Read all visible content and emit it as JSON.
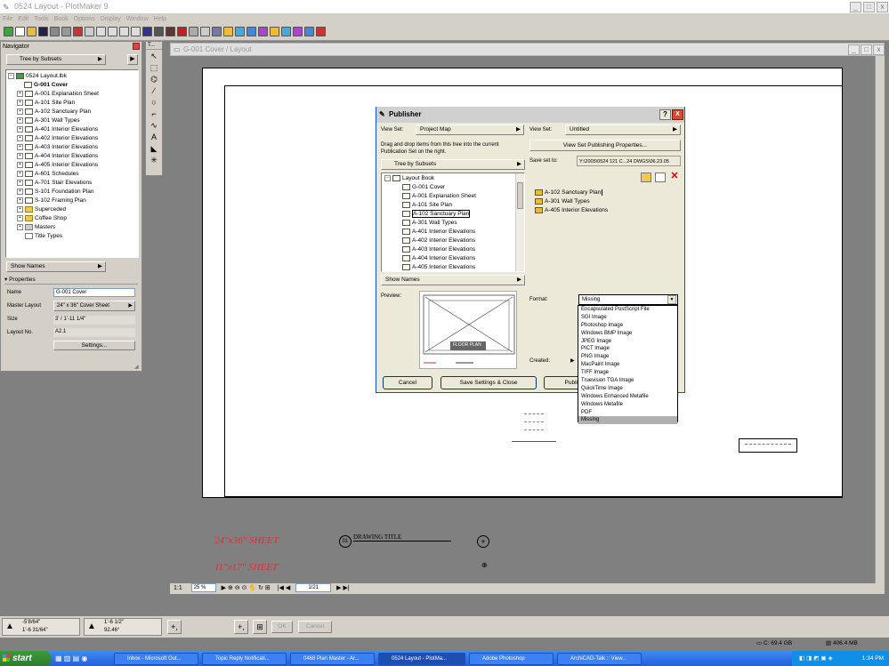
{
  "window": {
    "title": "0524 Layout - PlotMaker 9"
  },
  "menu": [
    "File",
    "Edit",
    "Tools",
    "Book",
    "Options",
    "Display",
    "Window",
    "Help"
  ],
  "navigator": {
    "title": "Navigator",
    "mode": "Tree by Subsets",
    "root": "0524 Layout.lbk",
    "items": [
      "G-001 Cover",
      "A-001 Explanation Sheet",
      "A-101 Site Plan",
      "A-102 Sanctuary Plan",
      "A-301 Wall Types",
      "A-401 Interior Elevations",
      "A-402 Interior Elevations",
      "A-403 Interior Elevations",
      "A-404 Interior Elevations",
      "A-405 Interior Elevations",
      "A-601 Schedules",
      "A-701 Stair Elevations",
      "S-101 Foundation Plan",
      "S-102 Framing Plan",
      "Superceded",
      "Coffee Shop",
      "Masters",
      "Title Types"
    ],
    "show_names": "Show Names",
    "properties": {
      "title": "Properties",
      "name_label": "Name",
      "name_value": "G-001 Cover",
      "master_label": "Master Layout",
      "master_value": "24\" x 36\" Cover Sheet",
      "size_label": "Size",
      "size_value": "3' / 1'-11 1/4\"",
      "layout_no_label": "Layout No.",
      "layout_no_value": "A2.1",
      "settings_button": "Settings..."
    }
  },
  "toolbox_title": "T...",
  "layout_window": {
    "title": "G-001 Cover / Layout"
  },
  "sheet_labels": {
    "a": "24\"x36\" SHEET",
    "b": "11\"x17\" SHEET",
    "drawing_number": "01",
    "drawing_title": "DRAWING TITLE"
  },
  "publisher": {
    "title": "Publisher",
    "help": "?",
    "close": "X",
    "left_viewset_label": "View Set:",
    "left_viewset_value": "Project Map",
    "right_viewset_label": "View Set:",
    "right_viewset_value": "Untitled",
    "instructions": "Drag and drop items from this tree into the current Publication Set on the right.",
    "view_set_props_button": "View Set Publishing Properties...",
    "save_set_label": "Save set to:",
    "save_set_path": "Y:\\2005\\0524 121 C...24 DWGS\\06.23.05",
    "tree_mode": "Tree by Subsets",
    "tree_root": "Layout Book",
    "tree_items": [
      "G-001 Cover",
      "A-001 Explanation Sheet",
      "A-101 Site Plan",
      "A-102 Sanctuary Plan",
      "A-301 Wall Types",
      "A-401 Interior Elevations",
      "A-402 Interior Elevations",
      "A-403 Interior Elevations",
      "A-404 Interior Elevations",
      "A-405 Interior Elevations"
    ],
    "publication_items": [
      "A-102 Sanctuary Plan",
      "A-301 Wall Types",
      "A-405 Interior Elevations"
    ],
    "show_names": "Show Names",
    "preview_label": "Preview:",
    "preview_tag": "FLOOR PLAN",
    "format_label": "Format:",
    "format_value": "Missing",
    "created_label": "Created:",
    "cancel_button": "Cancel",
    "save_close_button": "Save Settings & Close",
    "publish_button": "Publi",
    "format_options": [
      "Encapsulated PostScript File",
      "SGI Image",
      "Photoshop Image",
      "Windows BMP Image",
      "JPEG Image",
      "PICT Image",
      "PNG Image",
      "MacPaint Image",
      "TIFF Image",
      "Truevision TGA Image",
      "QuickTime Image",
      "Windows Enhanced Metafile",
      "Windows Metafile",
      "PDF",
      "Missing"
    ]
  },
  "statusbar": {
    "zoom": "25 %",
    "page": "1/21"
  },
  "coords": {
    "dx": "-5'8/64\"",
    "dy": "1'-6 31/64\"",
    "dr": "1'-6 1/2\"",
    "da": "92.46°",
    "ok": "OK",
    "cancel": "Cancel"
  },
  "disk": {
    "c": "C: 69.4 GB",
    "mem": "406.4 MB"
  },
  "taskbar": {
    "start": "start",
    "tasks": [
      "Inbox - Microsoft Out...",
      "Topic Reply Notificati...",
      "0468 Plan Master - Ar...",
      "0524 Layout - PlotMa...",
      "Adobe Photoshop",
      "ArchiCAD-Talk :: View..."
    ],
    "clock": "1:34 PM"
  }
}
